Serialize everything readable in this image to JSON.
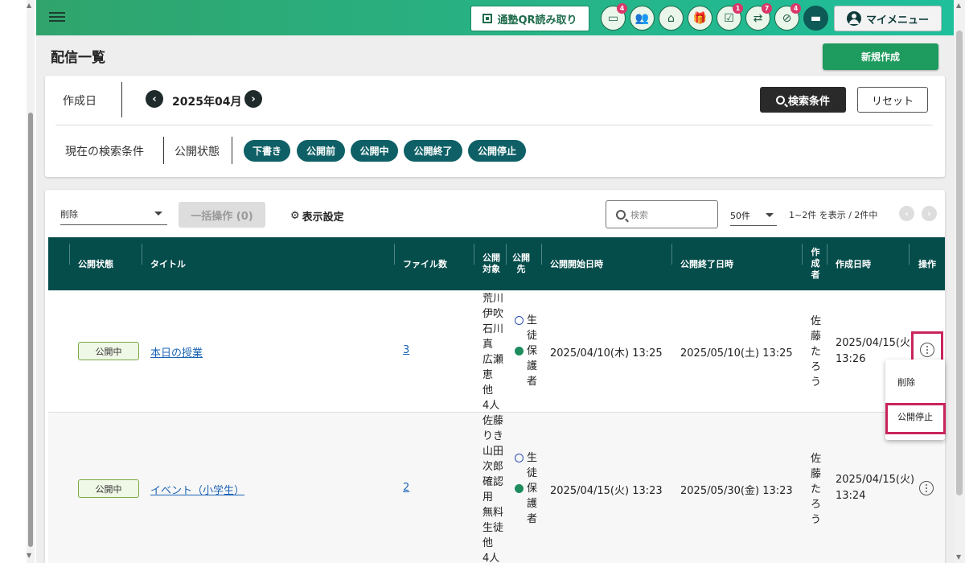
{
  "topbar": {
    "qr_label": "通塾QR読み取り",
    "my_menu_label": "マイメニュー",
    "icon_badges": [
      "4",
      "",
      "",
      "",
      "1",
      "7",
      "4",
      ""
    ]
  },
  "page": {
    "title": "配信一覧",
    "new_button": "新規作成"
  },
  "filter": {
    "date_label": "作成日",
    "month": "2025年04月",
    "search_button": "検索条件",
    "reset_button": "リセット",
    "current_conditions_label": "現在の検索条件",
    "status_label": "公開状態",
    "status_chips": [
      "下書き",
      "公開前",
      "公開中",
      "公開終了",
      "公開停止"
    ]
  },
  "toolbar": {
    "bulk_select_value": "削除",
    "bulk_button": "一括操作 (0)",
    "display_settings": "表示設定",
    "search_placeholder": "検索",
    "per_page": "50件",
    "pagination_text": "1~2件 を表示 / 2件中"
  },
  "table": {
    "headers": {
      "status": "公開状態",
      "title": "タイトル",
      "files": "ファイル数",
      "target": [
        "公開",
        "対象"
      ],
      "dest": [
        "公開",
        "先"
      ],
      "start": "公開開始日時",
      "end": "公開終了日時",
      "author": [
        "作",
        "成",
        "者"
      ],
      "created": "作成日時",
      "ops": "操作"
    },
    "rows": [
      {
        "status": "公開中",
        "title": "本日の授業",
        "files": "3",
        "target": [
          "荒川",
          "伊吹",
          "石川",
          "真",
          "広瀬",
          "恵",
          "他",
          "4人"
        ],
        "dest_student": [
          "生",
          "徒"
        ],
        "dest_parent": [
          "保",
          "護",
          "者"
        ],
        "start": "2025/04/10(木) 13:25",
        "end": "2025/05/10(土) 13:25",
        "author": [
          "佐",
          "藤",
          "た",
          "ろ",
          "う"
        ],
        "created": [
          "2025/04/15(火)",
          "13:26"
        ]
      },
      {
        "status": "公開中",
        "title": "イベント（小学生）",
        "files": "2",
        "target": [
          "佐藤",
          "りき",
          "山田",
          "次郎",
          "確認",
          "用",
          "無料",
          "生徒",
          "他",
          "4人"
        ],
        "dest_student": [
          "生",
          "徒"
        ],
        "dest_parent": [
          "保",
          "護",
          "者"
        ],
        "start": "2025/04/15(火) 13:23",
        "end": "2025/05/30(金) 13:23",
        "author": [
          "佐",
          "藤",
          "た",
          "ろ",
          "う"
        ],
        "created": [
          "2025/04/15(火)",
          "13:24"
        ]
      }
    ]
  },
  "popup_menu": {
    "items": [
      "削除",
      "公開停止"
    ]
  },
  "colors": {
    "header_bg": "#054d4b",
    "chip_bg": "#0e6066",
    "primary": "#1e9b5e",
    "highlight": "#c9245d",
    "link": "#1a63b5"
  }
}
